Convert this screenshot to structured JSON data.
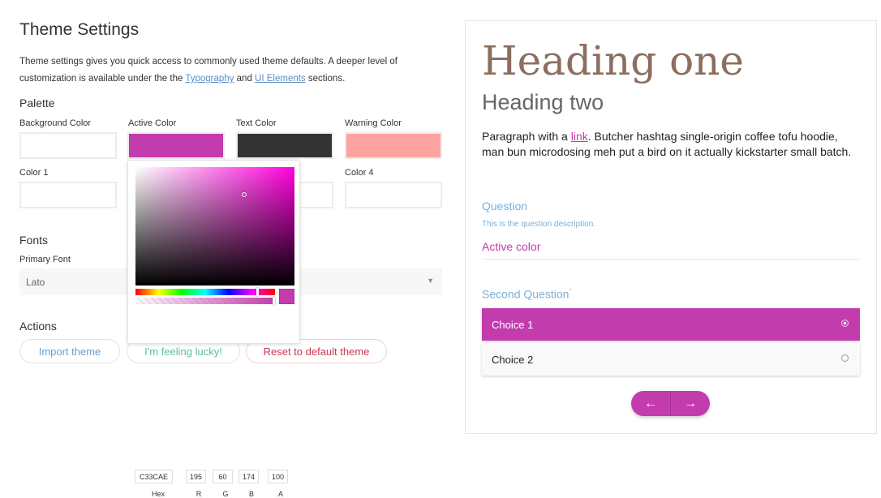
{
  "left": {
    "title": "Theme Settings",
    "intro_before": "Theme settings gives you quick access to commonly used theme defaults. A deeper level of customization is available under the the ",
    "link_typography": "Typography",
    "intro_and": " and ",
    "link_ui": "UI Elements",
    "intro_after": " sections.",
    "palette_heading": "Palette",
    "swatches": [
      {
        "label": "Background Color",
        "color": "#ffffff"
      },
      {
        "label": "Active Color",
        "color": "#c33cae"
      },
      {
        "label": "Text Color",
        "color": "#333333"
      },
      {
        "label": "Warning Color",
        "color": "#ffa3a0"
      },
      {
        "label": "Color 1",
        "color": "#ffffff"
      },
      {
        "label": "Color 4",
        "color": "#ffffff"
      }
    ],
    "fonts_heading": "Fonts",
    "primary_font_label": "Primary Font",
    "primary_font_value": "Lato",
    "actions_heading": "Actions",
    "buttons": {
      "import": "Import theme",
      "lucky": "I'm feeling lucky!",
      "reset": "Reset to default theme"
    },
    "button_colors": {
      "import": "#6a9ccf",
      "lucky": "#5cbf96",
      "reset": "#c9384f"
    }
  },
  "picker": {
    "hex": "C33CAE",
    "r": "195",
    "g": "60",
    "b": "174",
    "a": "100",
    "labels": {
      "hex": "Hex",
      "r": "R",
      "g": "G",
      "b": "B",
      "a": "A"
    },
    "hue_fraction": 0.88,
    "alpha_fraction": 1.0
  },
  "preview": {
    "heading_one": "Heading one",
    "heading_two": "Heading two",
    "para_before": "Paragraph with a ",
    "para_link": "link",
    "para_after": ". Butcher hashtag single-origin coffee tofu hoodie, man bun microdosing meh put a bird on it actually kickstarter small batch.",
    "question": "Question",
    "question_desc": "This is the question description.",
    "answer": "Active color",
    "second_question": "Second Question",
    "required_mark": "*",
    "choices": [
      {
        "label": "Choice 1",
        "selected": true
      },
      {
        "label": "Choice 2",
        "selected": false
      }
    ],
    "active_color": "#c33cae",
    "prev_icon": "arrow-left-icon",
    "next_icon": "arrow-right-icon"
  }
}
